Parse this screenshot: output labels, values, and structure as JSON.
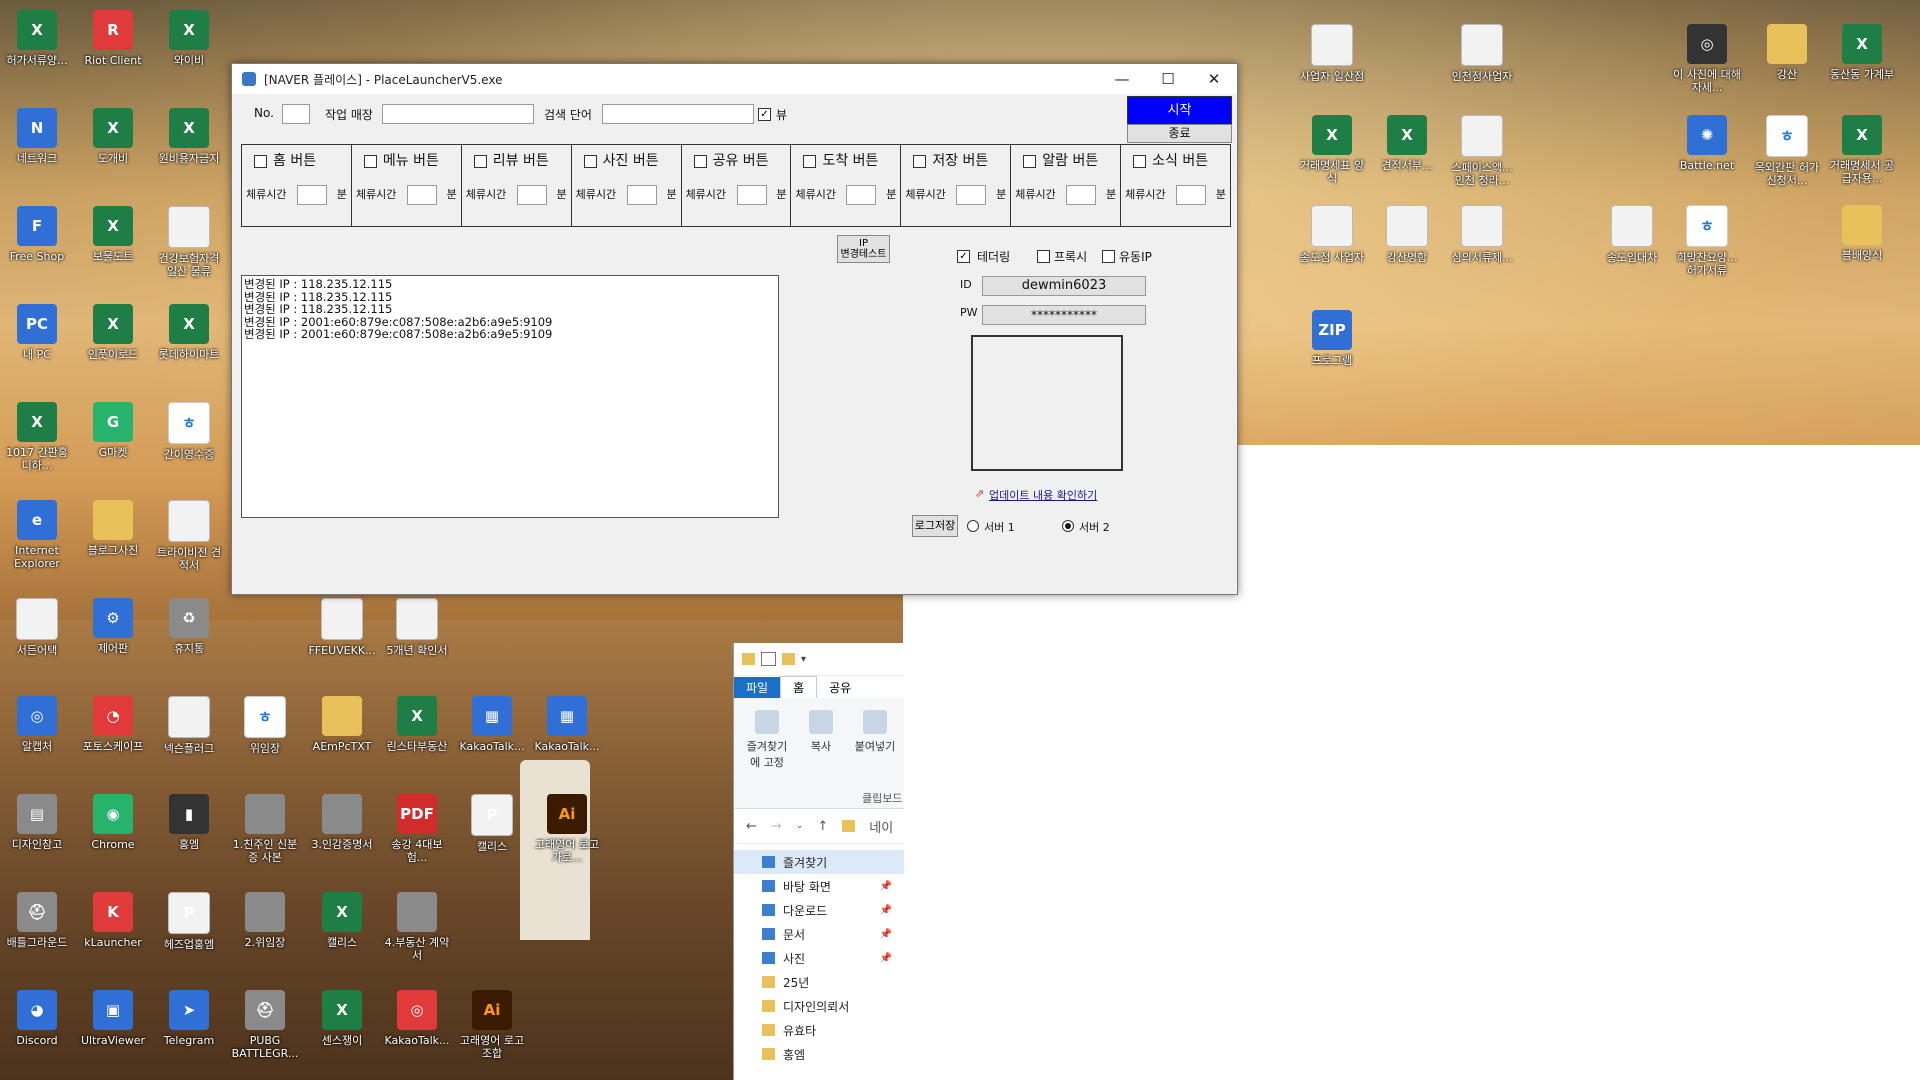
{
  "desktop": {
    "icons": [
      {
        "id": "i1",
        "label": "허가서류양...",
        "kind": "xl",
        "glyph": "X"
      },
      {
        "id": "i2",
        "label": "Riot Client",
        "kind": "red",
        "glyph": "R"
      },
      {
        "id": "i3",
        "label": "와이비",
        "kind": "xl",
        "glyph": "X"
      },
      {
        "id": "i4",
        "label": "네트워크",
        "kind": "blue",
        "glyph": "N"
      },
      {
        "id": "i5",
        "label": "도개비",
        "kind": "xl",
        "glyph": "X"
      },
      {
        "id": "i6",
        "label": "원비용자금지",
        "kind": "xl",
        "glyph": "X"
      },
      {
        "id": "i7",
        "label": "Free Shop",
        "kind": "blue",
        "glyph": "F"
      },
      {
        "id": "i8",
        "label": "보물도트",
        "kind": "xl",
        "glyph": "X"
      },
      {
        "id": "i9",
        "label": "건강보험자격 일산 물류",
        "kind": "doc",
        "glyph": ""
      },
      {
        "id": "i10",
        "label": "내 PC",
        "kind": "blue",
        "glyph": "PC"
      },
      {
        "id": "i11",
        "label": "인풋이로드",
        "kind": "xl",
        "glyph": "X"
      },
      {
        "id": "i12",
        "label": "롯데하이마트",
        "kind": "xl",
        "glyph": "X"
      },
      {
        "id": "i13",
        "label": "1017 간판홍디하...",
        "kind": "xl",
        "glyph": "X"
      },
      {
        "id": "i14",
        "label": "G마켓",
        "kind": "green",
        "glyph": "G"
      },
      {
        "id": "i15",
        "label": "간이영수증",
        "kind": "han",
        "glyph": "ㅎ"
      },
      {
        "id": "i16",
        "label": "Internet Explorer",
        "kind": "blue",
        "glyph": "e"
      },
      {
        "id": "i17",
        "label": "블로그사진",
        "kind": "fold",
        "glyph": ""
      },
      {
        "id": "i18",
        "label": "트라이비전 견적서",
        "kind": "doc",
        "glyph": ""
      },
      {
        "id": "i19",
        "label": "서든어택",
        "kind": "doc",
        "glyph": ""
      },
      {
        "id": "i20",
        "label": "제어판",
        "kind": "blue",
        "glyph": "⚙"
      },
      {
        "id": "i21",
        "label": "휴지통",
        "kind": "gray",
        "glyph": "♻"
      },
      {
        "id": "i22",
        "label": "알캡처",
        "kind": "blue",
        "glyph": "◎"
      },
      {
        "id": "i23",
        "label": "포토스케이프",
        "kind": "red",
        "glyph": "◔"
      },
      {
        "id": "i24",
        "label": "넥슨플러그",
        "kind": "doc",
        "glyph": ""
      },
      {
        "id": "i25",
        "label": "디자인참고",
        "kind": "gray",
        "glyph": "▤"
      },
      {
        "id": "i26",
        "label": "Chrome",
        "kind": "green",
        "glyph": "◉"
      },
      {
        "id": "i27",
        "label": "홍엠",
        "kind": "dark",
        "glyph": "▮"
      },
      {
        "id": "i28",
        "label": "배틀그라운드",
        "kind": "gray",
        "glyph": "⛑"
      },
      {
        "id": "i29",
        "label": "kLauncher",
        "kind": "red",
        "glyph": "K"
      },
      {
        "id": "i30",
        "label": "헤즈업홍엠",
        "kind": "doc",
        "glyph": "P"
      },
      {
        "id": "i31",
        "label": "Discord",
        "kind": "blue",
        "glyph": "◕"
      },
      {
        "id": "i32",
        "label": "UltraViewer",
        "kind": "blue",
        "glyph": "▣"
      },
      {
        "id": "i33",
        "label": "Telegram",
        "kind": "blue",
        "glyph": "➤"
      },
      {
        "id": "i34",
        "label": "사업자 일산점",
        "kind": "doc",
        "glyph": ""
      },
      {
        "id": "i35",
        "label": "인천점사업자",
        "kind": "doc",
        "glyph": ""
      },
      {
        "id": "i36",
        "label": "이 사진에 대해 자세...",
        "kind": "dark",
        "glyph": "◎"
      },
      {
        "id": "i37",
        "label": "강산",
        "kind": "fold",
        "glyph": ""
      },
      {
        "id": "i38",
        "label": "동산동 가계부",
        "kind": "xl",
        "glyph": "X"
      },
      {
        "id": "i39",
        "label": "거래명세표 양식",
        "kind": "xl",
        "glyph": "X"
      },
      {
        "id": "i40",
        "label": "견적서부...",
        "kind": "xl",
        "glyph": "X"
      },
      {
        "id": "i41",
        "label": "스페이스액... 인천 청라...",
        "kind": "doc",
        "glyph": ""
      },
      {
        "id": "i42",
        "label": "Battle.net",
        "kind": "blue",
        "glyph": "✺"
      },
      {
        "id": "i43",
        "label": "옥외간판 허가신청서...",
        "kind": "han",
        "glyph": "ㅎ"
      },
      {
        "id": "i44",
        "label": "거래명세서 공급자용...",
        "kind": "xl",
        "glyph": "X"
      },
      {
        "id": "i45",
        "label": "송도점 사업자",
        "kind": "doc",
        "glyph": ""
      },
      {
        "id": "i46",
        "label": "강산명함",
        "kind": "doc",
        "glyph": ""
      },
      {
        "id": "i47",
        "label": "심의서류제...",
        "kind": "doc",
        "glyph": ""
      },
      {
        "id": "i48",
        "label": "송도임대차",
        "kind": "doc",
        "glyph": ""
      },
      {
        "id": "i49",
        "label": "희망찬요양... 허가서류",
        "kind": "han",
        "glyph": "ㅎ"
      },
      {
        "id": "i50",
        "label": "블배양식",
        "kind": "fold",
        "glyph": ""
      },
      {
        "id": "i51",
        "label": "프로그램",
        "kind": "blue",
        "glyph": "ZIP"
      },
      {
        "id": "i52",
        "label": "FFEUVEKK...",
        "kind": "doc",
        "glyph": ""
      },
      {
        "id": "i53",
        "label": "5개년 확인서",
        "kind": "doc",
        "glyph": ""
      },
      {
        "id": "i54",
        "label": "위임장",
        "kind": "han",
        "glyph": "ㅎ"
      },
      {
        "id": "i55",
        "label": "AEmPcTXT",
        "kind": "fold",
        "glyph": ""
      },
      {
        "id": "i56",
        "label": "린스타부동산",
        "kind": "xl",
        "glyph": "X"
      },
      {
        "id": "i57",
        "label": "KakaoTalk...",
        "kind": "blue",
        "glyph": "▦"
      },
      {
        "id": "i58",
        "label": "KakaoTalk...",
        "kind": "blue",
        "glyph": "▦"
      },
      {
        "id": "i59",
        "label": "1.친주인 신분증 사본",
        "kind": "gray",
        "glyph": ""
      },
      {
        "id": "i60",
        "label": "3.인감증명서",
        "kind": "gray",
        "glyph": ""
      },
      {
        "id": "i61",
        "label": "송강 4대보험...",
        "kind": "pdf",
        "glyph": "PDF"
      },
      {
        "id": "i62",
        "label": "캘리스",
        "kind": "doc",
        "glyph": "P"
      },
      {
        "id": "i63",
        "label": "고래영어 로고가로...",
        "kind": "ai",
        "glyph": "Ai"
      },
      {
        "id": "i64",
        "label": "2.위임장",
        "kind": "gray",
        "glyph": ""
      },
      {
        "id": "i65",
        "label": "캘리스",
        "kind": "xl",
        "glyph": "X"
      },
      {
        "id": "i66",
        "label": "4.부동산 계약서",
        "kind": "gray",
        "glyph": ""
      },
      {
        "id": "i67",
        "label": "PUBG BATTLEGR...",
        "kind": "gray",
        "glyph": "⛑"
      },
      {
        "id": "i68",
        "label": "센스쟁이",
        "kind": "xl",
        "glyph": "X"
      },
      {
        "id": "i69",
        "label": "KakaoTalk...",
        "kind": "red",
        "glyph": "◎"
      },
      {
        "id": "i70",
        "label": "고래영어 로고조합",
        "kind": "ai",
        "glyph": "Ai"
      }
    ]
  },
  "window": {
    "title": "[NAVER 플레이스] - PlaceLauncherV5.exe",
    "minimize": "—",
    "maximize": "☐",
    "close": "✕",
    "no_label": "No.",
    "no_value": "",
    "store_label": "작업 매장",
    "store_value": "",
    "keyword_label": "검색 단어",
    "keyword_value": "",
    "view_label": "뷰",
    "view_checked": "✓",
    "start_label": "시작",
    "end_label": "종료",
    "buttons": [
      {
        "label": "홈 버튼",
        "stay": "체류시간",
        "unit": "분"
      },
      {
        "label": "메뉴 버튼",
        "stay": "체류시간",
        "unit": "분"
      },
      {
        "label": "리뷰 버튼",
        "stay": "체류시간",
        "unit": "분"
      },
      {
        "label": "사진 버튼",
        "stay": "체류시간",
        "unit": "분"
      },
      {
        "label": "공유 버튼",
        "stay": "체류시간",
        "unit": "분"
      },
      {
        "label": "도착 버튼",
        "stay": "체류시간",
        "unit": "분"
      },
      {
        "label": "저장 버튼",
        "stay": "체류시간",
        "unit": "분"
      },
      {
        "label": "알람 버튼",
        "stay": "체류시간",
        "unit": "분"
      },
      {
        "label": "소식 버튼",
        "stay": "체류시간",
        "unit": "분"
      }
    ],
    "ip_test_label_line1": "IP",
    "ip_test_label_line2": "변경테스트",
    "log_lines": [
      "변경된 IP : 118.235.12.115",
      "변경된 IP : 118.235.12.115",
      "변경된 IP : 118.235.12.115",
      "변경된 IP : 2001:e60:879e:c087:508e:a2b6:a9e5:9109",
      "변경된 IP : 2001:e60:879e:c087:508e:a2b6:a9e5:9109"
    ],
    "tethering_label": "테더링",
    "tethering_checked": "✓",
    "proxy_label": "프록시",
    "dynamic_ip_label": "유동IP",
    "id_label": "ID",
    "id_value": "dewmin6023",
    "pw_label": "PW",
    "pw_value": "***********",
    "update_link": "업데이트 내용 확인하기",
    "log_save_label": "로그저장",
    "server1_label": "서버 1",
    "server2_label": "서버 2",
    "server_selected": "서버 2"
  },
  "explorer": {
    "tabs": [
      "파일",
      "홈",
      "공유"
    ],
    "ribbon": [
      "즐겨찾기에 고정",
      "복사",
      "붙여넣기"
    ],
    "ribbon_group": "클립보드",
    "path_text": "네이",
    "tree": [
      {
        "label": "즐겨찾기",
        "pinned": false,
        "selected": true
      },
      {
        "label": "바탕 화면",
        "pinned": true
      },
      {
        "label": "다운로드",
        "pinned": true
      },
      {
        "label": "문서",
        "pinned": true
      },
      {
        "label": "사진",
        "pinned": true
      },
      {
        "label": "25년",
        "pinned": false
      },
      {
        "label": "디자인의뢰서",
        "pinned": false
      },
      {
        "label": "유효타",
        "pinned": false
      },
      {
        "label": "홍엠",
        "pinned": false
      }
    ]
  }
}
